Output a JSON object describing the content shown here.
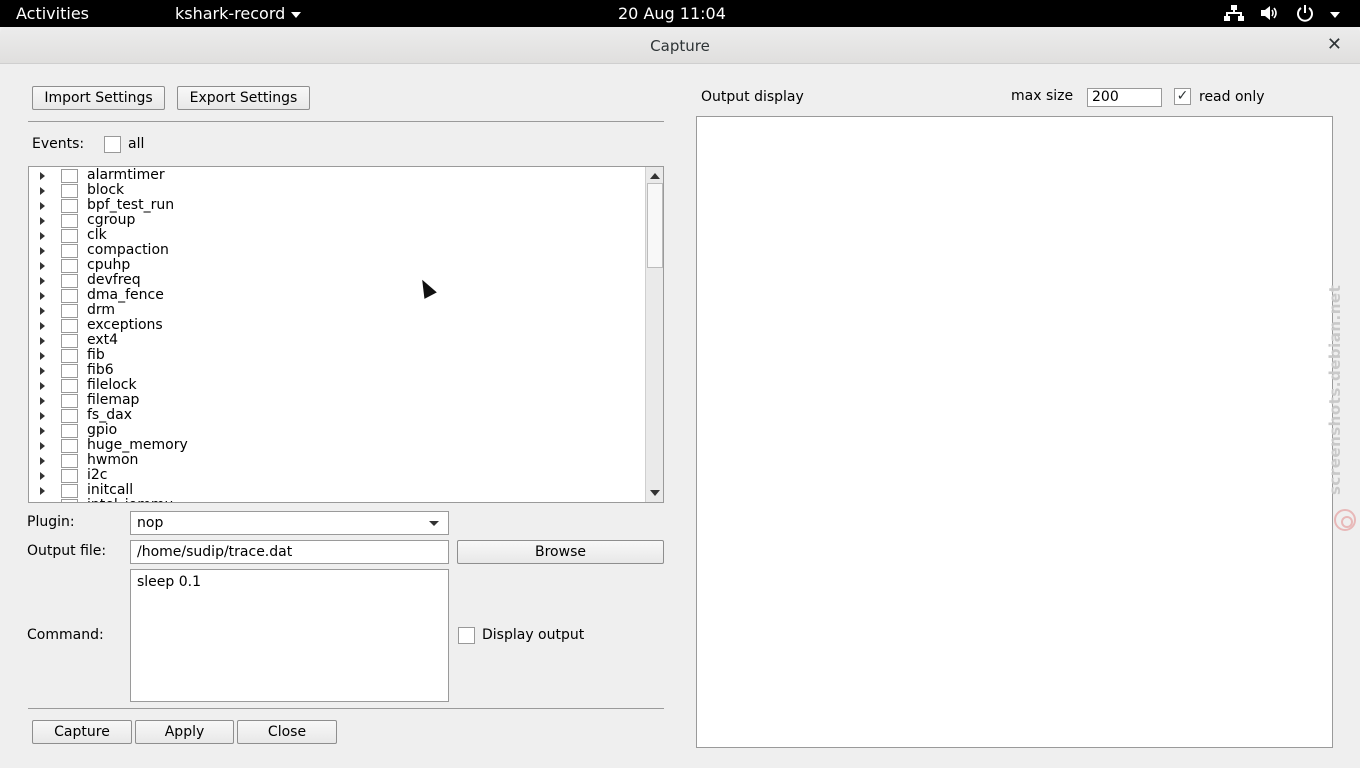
{
  "topbar": {
    "activities": "Activities",
    "app_name": "kshark-record",
    "clock": "20 Aug  11:04",
    "icons": [
      "network-icon",
      "volume-icon",
      "power-icon",
      "chevron-down-icon"
    ]
  },
  "window": {
    "title": "Capture",
    "close_glyph": "✕"
  },
  "toolbar": {
    "import_label": "Import Settings",
    "export_label": "Export Settings"
  },
  "events": {
    "label": "Events:",
    "all_label": "all",
    "all_checked": false,
    "items": [
      "alarmtimer",
      "block",
      "bpf_test_run",
      "cgroup",
      "clk",
      "compaction",
      "cpuhp",
      "devfreq",
      "dma_fence",
      "drm",
      "exceptions",
      "ext4",
      "fib",
      "fib6",
      "filelock",
      "filemap",
      "fs_dax",
      "gpio",
      "huge_memory",
      "hwmon",
      "i2c",
      "initcall",
      "intel_iommu"
    ]
  },
  "plugin": {
    "label": "Plugin:",
    "value": "nop"
  },
  "output_file": {
    "label": "Output file:",
    "value": "/home/sudip/trace.dat",
    "browse_label": "Browse"
  },
  "command": {
    "label": "Command:",
    "value": "sleep 0.1",
    "display_output_label": "Display output",
    "display_output_checked": false
  },
  "actions": {
    "capture_label": "Capture",
    "apply_label": "Apply",
    "close_label": "Close"
  },
  "output_display": {
    "label": "Output display",
    "max_size_label": "max size",
    "max_size_value": "200",
    "read_only_label": "read only",
    "read_only_checked": true
  },
  "watermark": "screenshots.debian.net"
}
